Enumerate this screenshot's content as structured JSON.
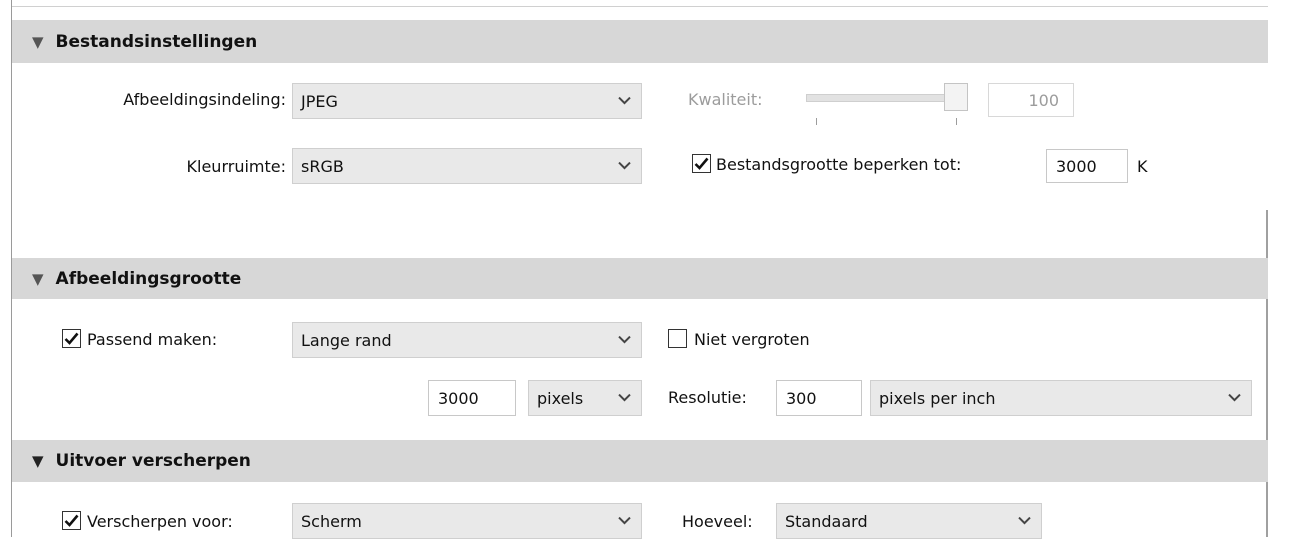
{
  "sections": {
    "file_settings": {
      "title": "Bestandsinstellingen",
      "image_format": {
        "label": "Afbeeldingsindeling:",
        "value": "JPEG"
      },
      "quality": {
        "label": "Kwaliteit:",
        "value": "100",
        "slider_fraction": 1.0
      },
      "color_space": {
        "label": "Kleurruimte:",
        "value": "sRGB"
      },
      "limit_file_size": {
        "label": "Bestandsgrootte beperken tot:",
        "checked": true,
        "value": "3000",
        "unit": "K"
      }
    },
    "image_sizing": {
      "title": "Afbeeldingsgrootte",
      "resize_to_fit": {
        "label": "Passend maken:",
        "checked": true,
        "value": "Lange rand"
      },
      "dont_enlarge": {
        "label": "Niet vergroten",
        "checked": false
      },
      "size": {
        "value": "3000",
        "unit": "pixels"
      },
      "resolution": {
        "label": "Resolutie:",
        "value": "300",
        "unit": "pixels per inch"
      }
    },
    "output_sharpening": {
      "title": "Uitvoer verscherpen",
      "sharpen_for": {
        "label": "Verscherpen voor:",
        "checked": true,
        "value": "Scherm"
      },
      "amount": {
        "label": "Hoeveel:",
        "value": "Standaard"
      }
    }
  },
  "icons": {
    "collapse": "triangle-down-icon",
    "dropdown": "chevron-down-icon",
    "check": "checkmark-icon"
  },
  "colors": {
    "header_bg": "#d7d7d7",
    "dropdown_bg": "#e9e9e9",
    "disabled_text": "#9c9c9c"
  }
}
